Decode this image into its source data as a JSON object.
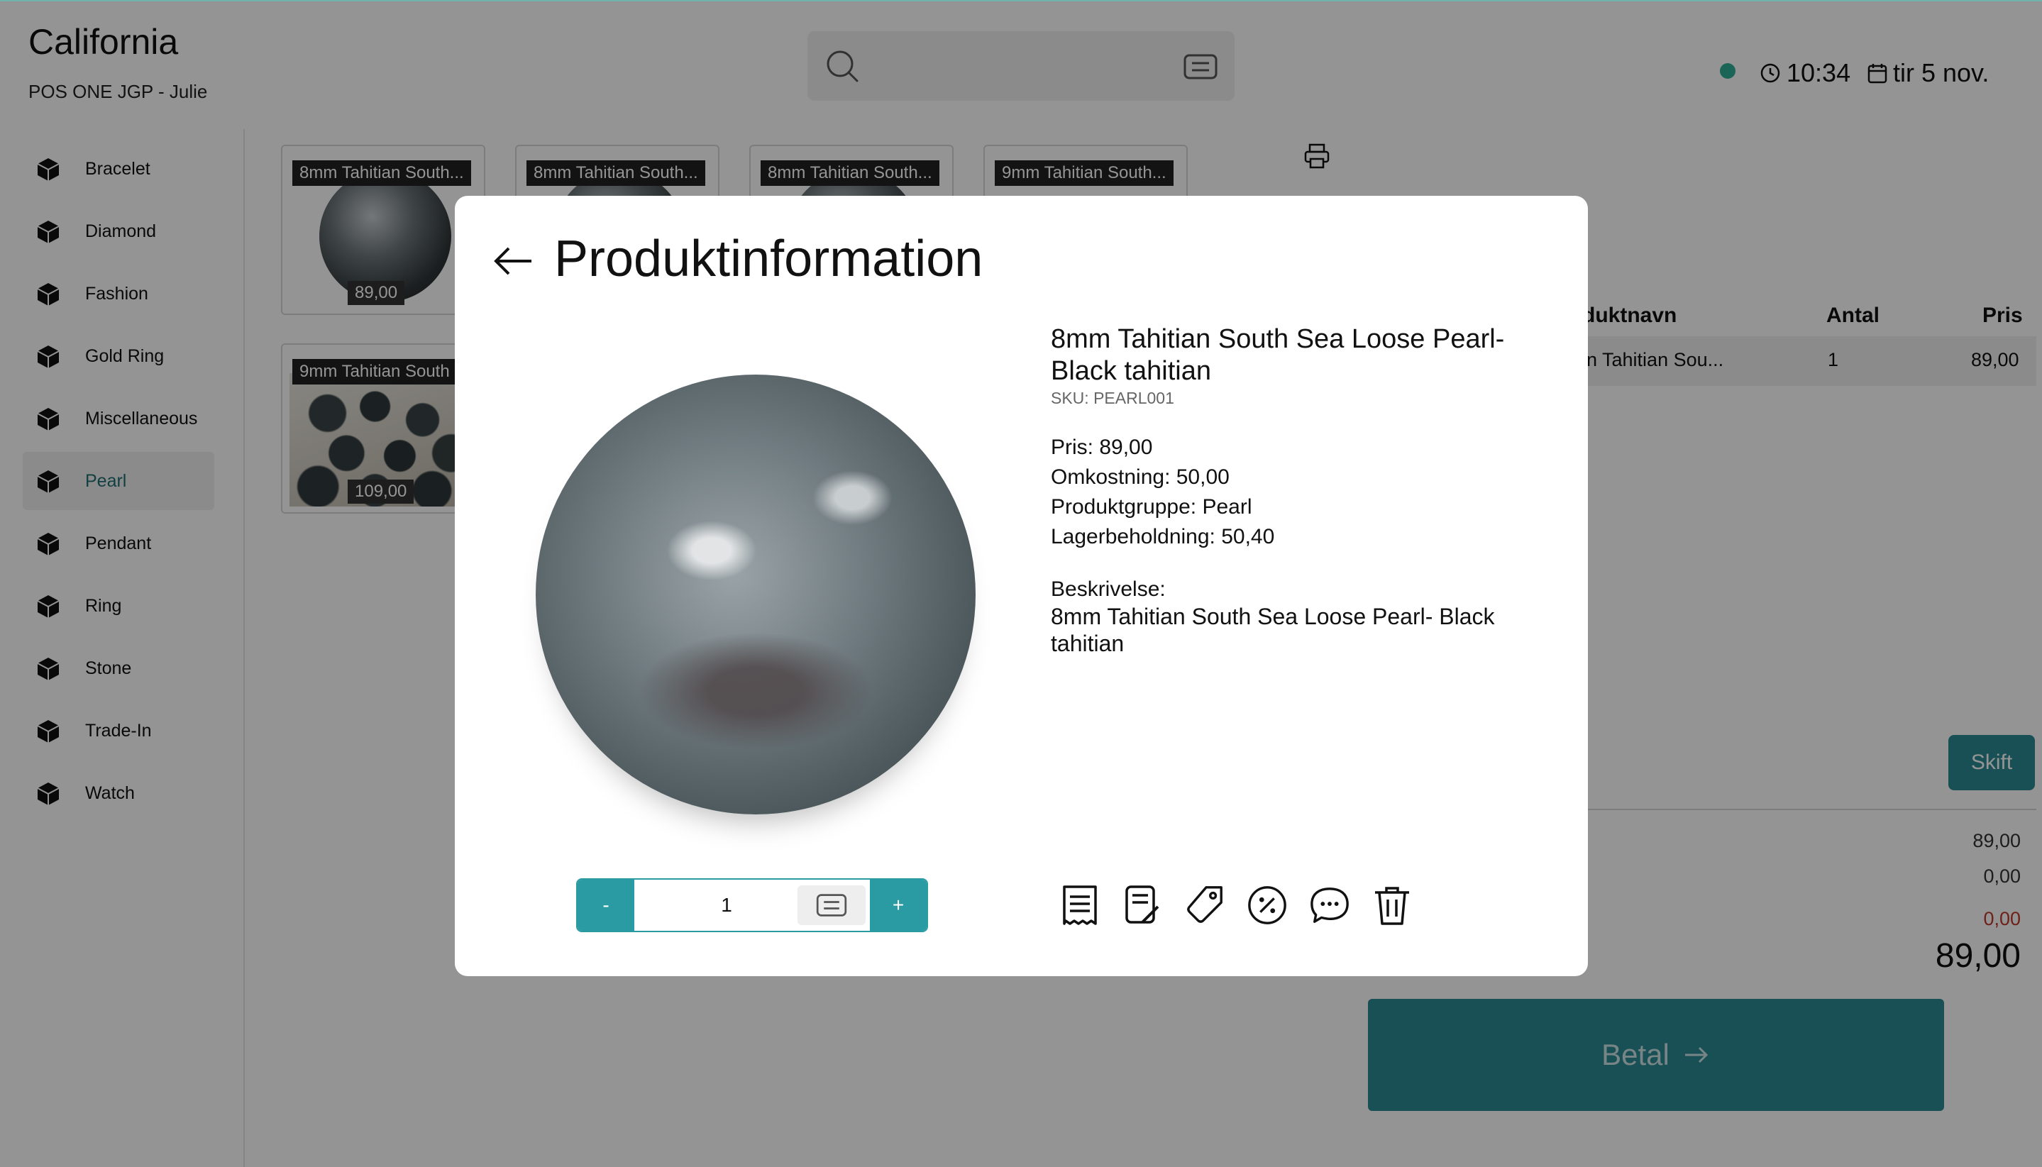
{
  "header": {
    "store_name": "California",
    "register": "POS ONE JGP - Julie",
    "time": "10:34",
    "date": "tir 5 nov."
  },
  "sidebar": {
    "items": [
      {
        "label": "Bracelet"
      },
      {
        "label": "Diamond"
      },
      {
        "label": "Fashion"
      },
      {
        "label": "Gold Ring"
      },
      {
        "label": "Miscellaneous"
      },
      {
        "label": "Pearl",
        "active": true
      },
      {
        "label": "Pendant"
      },
      {
        "label": "Ring"
      },
      {
        "label": "Stone"
      },
      {
        "label": "Trade-In"
      },
      {
        "label": "Watch"
      }
    ]
  },
  "products": [
    {
      "name": "8mm Tahitian South...",
      "price": "89,00"
    },
    {
      "name": "8mm Tahitian South...",
      "price": ""
    },
    {
      "name": "8mm Tahitian South...",
      "price": ""
    },
    {
      "name": "9mm Tahitian South...",
      "price": ""
    },
    {
      "name": "9mm Tahitian South",
      "price": "109,00"
    }
  ],
  "cart": {
    "headers": {
      "name": "duktnavn",
      "qty": "Antal",
      "price": "Pris"
    },
    "rows": [
      {
        "name": "n Tahitian Sou...",
        "qty": "1",
        "price": "89,00"
      }
    ],
    "shift_label": "Skift",
    "summary": [
      "89,00",
      "0,00",
      "0,00"
    ],
    "total": "89,00",
    "pay_label": "Betal",
    "colors": {
      "accent": "#2a8a93",
      "negative": "#c0392b"
    }
  },
  "modal": {
    "title": "Produktinformation",
    "product_name": "8mm Tahitian South Sea Loose Pearl- Black tahitian",
    "sku": "SKU: PEARL001",
    "info": [
      "Pris: 89,00",
      "Omkostning: 50,00",
      "Produktgruppe: Pearl",
      "Lagerbeholdning: 50,40"
    ],
    "description_label": "Beskrivelse:",
    "description": "8mm Tahitian South Sea Loose Pearl- Black tahitian",
    "quantity": {
      "minus": "-",
      "value": "1",
      "plus": "+"
    },
    "actions": [
      "receipt-icon",
      "edit-note-icon",
      "tag-icon",
      "percent-icon",
      "comment-icon",
      "trash-icon"
    ]
  }
}
